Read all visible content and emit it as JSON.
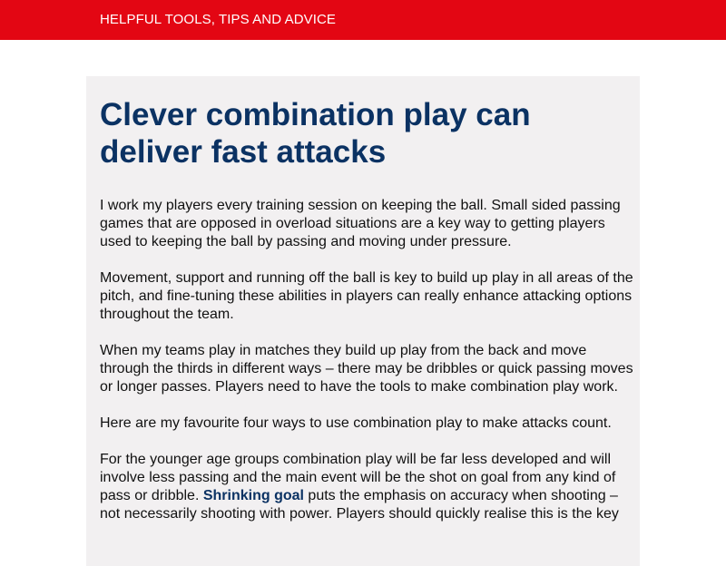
{
  "header": {
    "banner_text": "HELPFUL TOOLS, TIPS AND ADVICE",
    "banner_color": "#e30613"
  },
  "article": {
    "title": "Clever combination play can deliver fast attacks",
    "title_color": "#0b3263",
    "background_color": "#f2f0f1",
    "paragraphs": [
      "I work my players every training session on keeping the ball. Small sided passing games that are opposed in overload situations are a key way to getting players used to keeping the ball by passing and moving under pressure.",
      "Movement, support and running off the ball is key to build up play in all areas of the pitch, and fine-tuning these abilities in players can really enhance attacking options throughout the team.",
      "When my teams play in matches they build up play from the back and move through the thirds in different ways – there may be dribbles or quick passing moves or longer passes. Players need to have the tools to make combination play work.",
      "Here are my favourite four ways to use combination play to make attacks count."
    ],
    "last_paragraph": {
      "before_link": "For the younger age groups combination play will be far less developed and will involve less passing and the main event will be the shot on goal from any kind of pass or dribble. ",
      "link_text": "Shrinking goal",
      "after_link": " puts the emphasis on accuracy when shooting – not necessarily shooting with power. Players should quickly realise this is the key"
    }
  }
}
